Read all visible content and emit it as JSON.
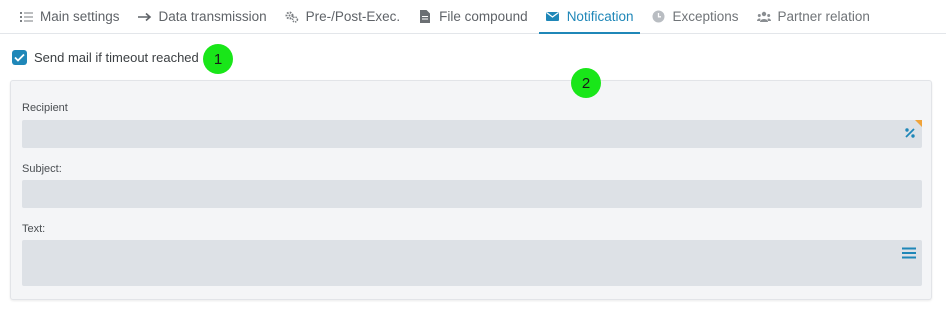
{
  "tabs": [
    {
      "label": "Main settings",
      "icon": "list-icon"
    },
    {
      "label": "Data transmission",
      "icon": "arrow-right-icon"
    },
    {
      "label": "Pre-/Post-Exec.",
      "icon": "gears-icon"
    },
    {
      "label": "File compound",
      "icon": "file-icon"
    },
    {
      "label": "Notification",
      "icon": "envelope-icon",
      "active": true
    },
    {
      "label": "Exceptions",
      "icon": "clock-icon"
    },
    {
      "label": "Partner relation",
      "icon": "people-icon"
    }
  ],
  "notification": {
    "send_mail_label": "Send mail if timeout reached",
    "send_mail_checked": true
  },
  "markers": [
    "1",
    "2"
  ],
  "form": {
    "recipient_label": "Recipient",
    "recipient_value": "",
    "subject_label": "Subject:",
    "subject_value": "",
    "text_label": "Text:",
    "text_value": ""
  },
  "colors": {
    "accent": "#1f87b8",
    "marker": "#19e619",
    "field_bg": "#dde1e6",
    "required_corner": "#f0a33a"
  }
}
